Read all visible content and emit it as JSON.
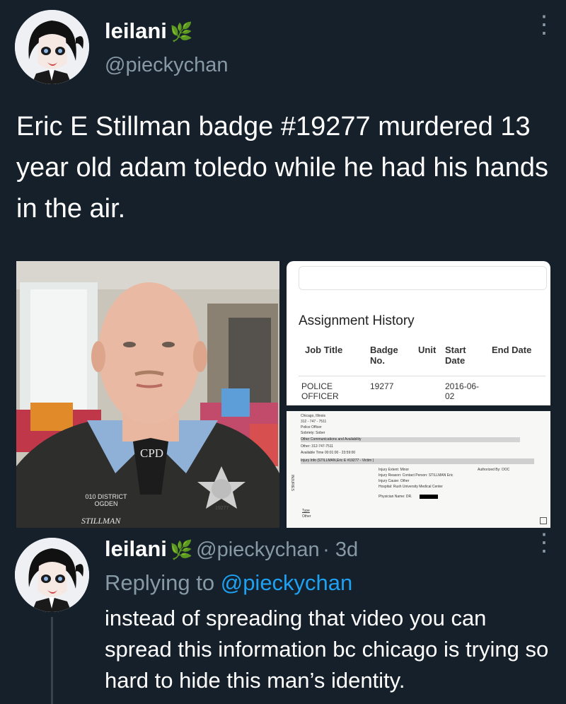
{
  "tweet": {
    "display_name": "leilani",
    "name_emoji": "🌿",
    "handle": "@pieckychan",
    "text": "Eric E Stillman  badge #19277 murdered 13 year old adam toledo while he had his hands in the air.",
    "more_icon": "⋮"
  },
  "photo": {
    "uniform_patch": "CPD",
    "shoulder_patch": "010 DISTRICT OGDEN",
    "name_tag": "STILLMAN",
    "badge_number": "19277"
  },
  "document": {
    "title": "Assignment History",
    "columns": [
      "Job Title",
      "Badge No.",
      "Unit",
      "Start Date",
      "End Date"
    ],
    "row": {
      "job_title": "POLICE OFFICER",
      "badge": "19277",
      "unit": "",
      "start_date": "2016-06-02",
      "end_date": ""
    },
    "lower_lines": [
      "Chicago, Illinois",
      "312 - 747 - 7511",
      "Police Officer",
      "Sobriety: Sober",
      "Other Communications and Availability",
      "Other:      312-747-7511",
      "Available Time  00:01:00 - 23:59:00",
      "Injury Info (STILLMAN,Eric E  #19277 - Victim )",
      "Injury Extent:  Minor",
      "Injury Reason:  Contact Person: STILLMAN Eric",
      "Injury Cause:  Other",
      "Hospital:  Rush University Medical Center",
      "Physician Name: DR.",
      "Authorized By:  OOC",
      "INJURIES",
      "Type",
      "Other"
    ]
  },
  "reply": {
    "display_name": "leilani",
    "name_emoji": "🌿",
    "handle": "@pieckychan",
    "time": "· 3d",
    "replying_label": "Replying to",
    "replying_handle": "@pieckychan",
    "text": "instead of spreading that video you can spread this information bc  chicago is trying so hard to hide this man’s identity.",
    "more_icon": "⋮"
  },
  "colors": {
    "background": "#15202b",
    "secondary_text": "#8899a6",
    "link": "#1da1f2"
  }
}
